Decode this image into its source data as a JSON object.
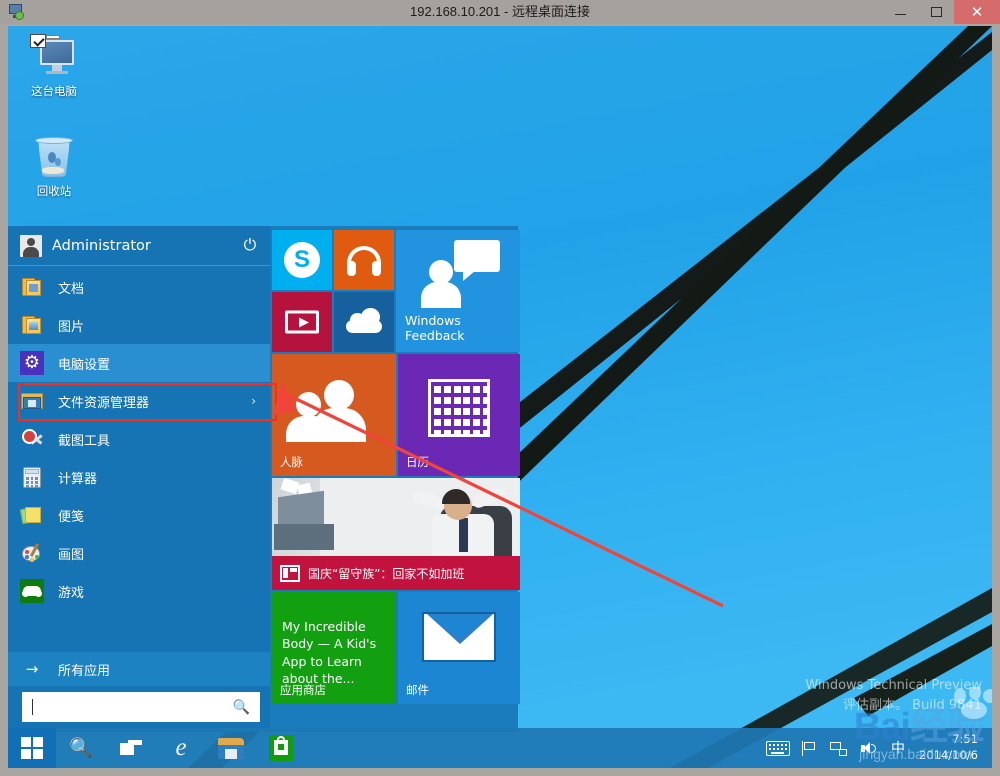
{
  "window": {
    "title": "192.168.10.201 - 远程桌面连接",
    "icon": "remote-desktop-icon",
    "minimize_label": "—",
    "maximize_label": "□",
    "close_label": "✕"
  },
  "desktop": {
    "icons": [
      {
        "label": "这台电脑",
        "icon": "this-pc-icon"
      },
      {
        "label": "回收站",
        "icon": "recycle-bin-icon"
      }
    ],
    "watermark": {
      "line1": "Windows Technical Preview",
      "line2": "评估副本。 Build 9841"
    },
    "site_watermark": {
      "logo": "Bai",
      "logo_cn": "经验",
      "url": "jingyan.baidu.com"
    }
  },
  "start_menu": {
    "user": {
      "name": "Administrator",
      "avatar_icon": "user-avatar-icon",
      "power_icon": "power-icon",
      "power_glyph": "⏻"
    },
    "items": [
      {
        "label": "文档",
        "icon": "folder-documents-icon",
        "selected": false,
        "chevron": ""
      },
      {
        "label": "图片",
        "icon": "folder-pictures-icon",
        "selected": false,
        "chevron": ""
      },
      {
        "label": "电脑设置",
        "icon": "settings-gear-icon",
        "selected": true,
        "chevron": ""
      },
      {
        "label": "文件资源管理器",
        "icon": "file-explorer-icon",
        "selected": false,
        "chevron": "›"
      },
      {
        "label": "截图工具",
        "icon": "snipping-tool-icon",
        "selected": false,
        "chevron": ""
      },
      {
        "label": "计算器",
        "icon": "calculator-icon",
        "selected": false,
        "chevron": ""
      },
      {
        "label": "便笺",
        "icon": "sticky-notes-icon",
        "selected": false,
        "chevron": ""
      },
      {
        "label": "画图",
        "icon": "paint-icon",
        "selected": false,
        "chevron": ""
      },
      {
        "label": "游戏",
        "icon": "games-icon",
        "selected": false,
        "chevron": ""
      }
    ],
    "all_apps": {
      "label": "所有应用",
      "arrow": "→",
      "icon": "arrow-right-icon"
    },
    "search": {
      "value": "",
      "placeholder": "",
      "icon": "search-icon"
    },
    "tiles": [
      {
        "name": "skype",
        "label": "",
        "icon": "skype-icon",
        "color": "#00aff0"
      },
      {
        "name": "music",
        "label": "",
        "icon": "headphones-icon",
        "color": "#e05a10"
      },
      {
        "name": "video",
        "label": "",
        "icon": "video-play-icon",
        "color": "#b5123e"
      },
      {
        "name": "onedrive",
        "label": "",
        "icon": "cloud-icon",
        "color": "#16609e"
      },
      {
        "name": "feedback",
        "label": "Windows\nFeedback",
        "line1": "Windows",
        "line2": "Feedback",
        "icon": "feedback-person-icon",
        "color": "#2293df"
      },
      {
        "name": "people",
        "label": "人脉",
        "icon": "people-icon",
        "color": "#d65a20"
      },
      {
        "name": "calendar",
        "label": "日历",
        "icon": "calendar-grid-icon",
        "color": "#6a28b5"
      },
      {
        "name": "news",
        "label": "国庆“留守族”：回家不如加班",
        "icon": "news-icon",
        "color": "#c2123e"
      },
      {
        "name": "store",
        "label": "应用商店",
        "headline": "My Incredible Body — A Kid's App to Learn about the...",
        "icon": "store-icon",
        "color": "#12a010"
      },
      {
        "name": "mail",
        "label": "邮件",
        "icon": "envelope-icon",
        "color": "#1c86d2"
      }
    ]
  },
  "taskbar": {
    "buttons": [
      {
        "name": "start",
        "icon": "windows-logo-icon"
      },
      {
        "name": "search",
        "icon": "search-icon"
      },
      {
        "name": "task-view",
        "icon": "task-view-icon"
      },
      {
        "name": "internet-explorer",
        "icon": "internet-explorer-icon",
        "glyph": "e"
      },
      {
        "name": "file-explorer",
        "icon": "file-explorer-icon"
      },
      {
        "name": "store",
        "icon": "store-bag-icon"
      }
    ],
    "tray": [
      {
        "name": "touch-keyboard",
        "icon": "keyboard-icon"
      },
      {
        "name": "action-center",
        "icon": "flag-icon"
      },
      {
        "name": "network",
        "icon": "network-icon"
      },
      {
        "name": "volume",
        "icon": "volume-icon"
      },
      {
        "name": "ime",
        "icon": "ime-icon",
        "glyph": "中"
      }
    ],
    "clock": {
      "time": "7:51",
      "date": "2014/10/6"
    }
  },
  "annotation": {
    "highlight_color": "#ef3124",
    "arrow_color": "#f0453a",
    "target": "电脑设置"
  }
}
